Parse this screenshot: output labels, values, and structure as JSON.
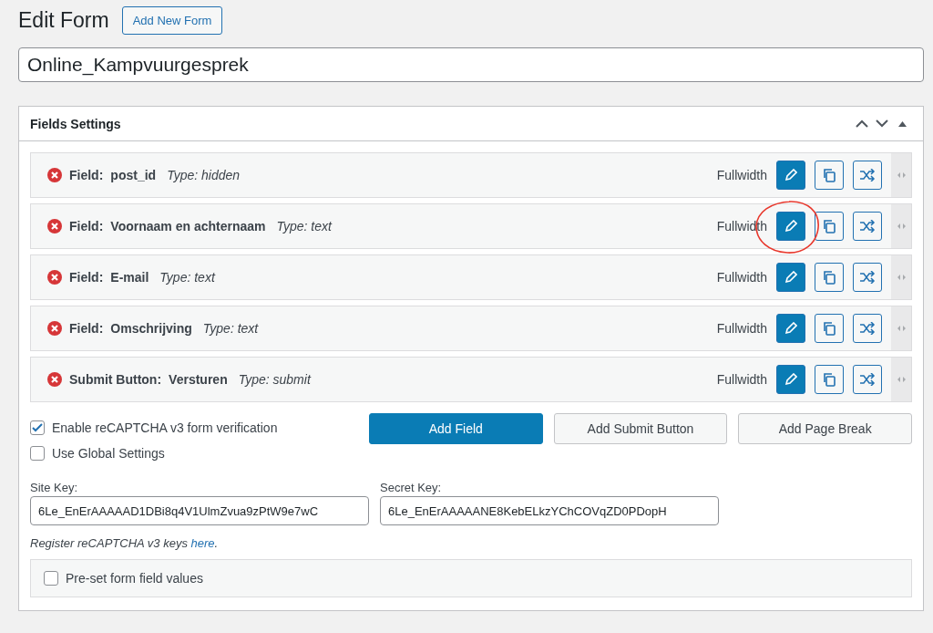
{
  "page": {
    "title": "Edit Form",
    "add_button": "Add New Form"
  },
  "form_title": {
    "value": "Online_Kampvuurgesprek"
  },
  "panel": {
    "title": "Fields Settings",
    "fields": [
      {
        "prefix": "Field:",
        "name": "post_id",
        "type": "Type: hidden",
        "width": "Fullwidth",
        "annotated": false
      },
      {
        "prefix": "Field:",
        "name": "Voornaam en achternaam",
        "type": "Type: text",
        "width": "Fullwidth",
        "annotated": true
      },
      {
        "prefix": "Field:",
        "name": "E-mail",
        "type": "Type: text",
        "width": "Fullwidth",
        "annotated": false
      },
      {
        "prefix": "Field:",
        "name": "Omschrijving",
        "type": "Type: text",
        "width": "Fullwidth",
        "annotated": false
      },
      {
        "prefix": "Submit Button:",
        "name": "Versturen",
        "type": "Type: submit",
        "width": "Fullwidth",
        "annotated": false
      }
    ],
    "options": [
      {
        "label": "Enable reCAPTCHA v3 form verification",
        "checked": true
      },
      {
        "label": "Use Global Settings",
        "checked": false
      }
    ],
    "buttons": [
      {
        "label": "Add Field",
        "primary": true
      },
      {
        "label": "Add Submit Button",
        "primary": false
      },
      {
        "label": "Add Page Break",
        "primary": false
      }
    ],
    "keys": [
      {
        "label": "Site Key:",
        "value": "6Le_EnErAAAAAD1DBi8q4V1UlmZvua9zPtW9e7wC"
      },
      {
        "label": "Secret Key:",
        "value": "6Le_EnErAAAAANE8KebELkzYChCOVqZD0PDopH"
      }
    ],
    "register": {
      "before": "Register reCAPTCHA v3 keys ",
      "link": "here",
      "after": "."
    },
    "preset": {
      "label": "Pre-set form field values",
      "checked": false
    }
  }
}
